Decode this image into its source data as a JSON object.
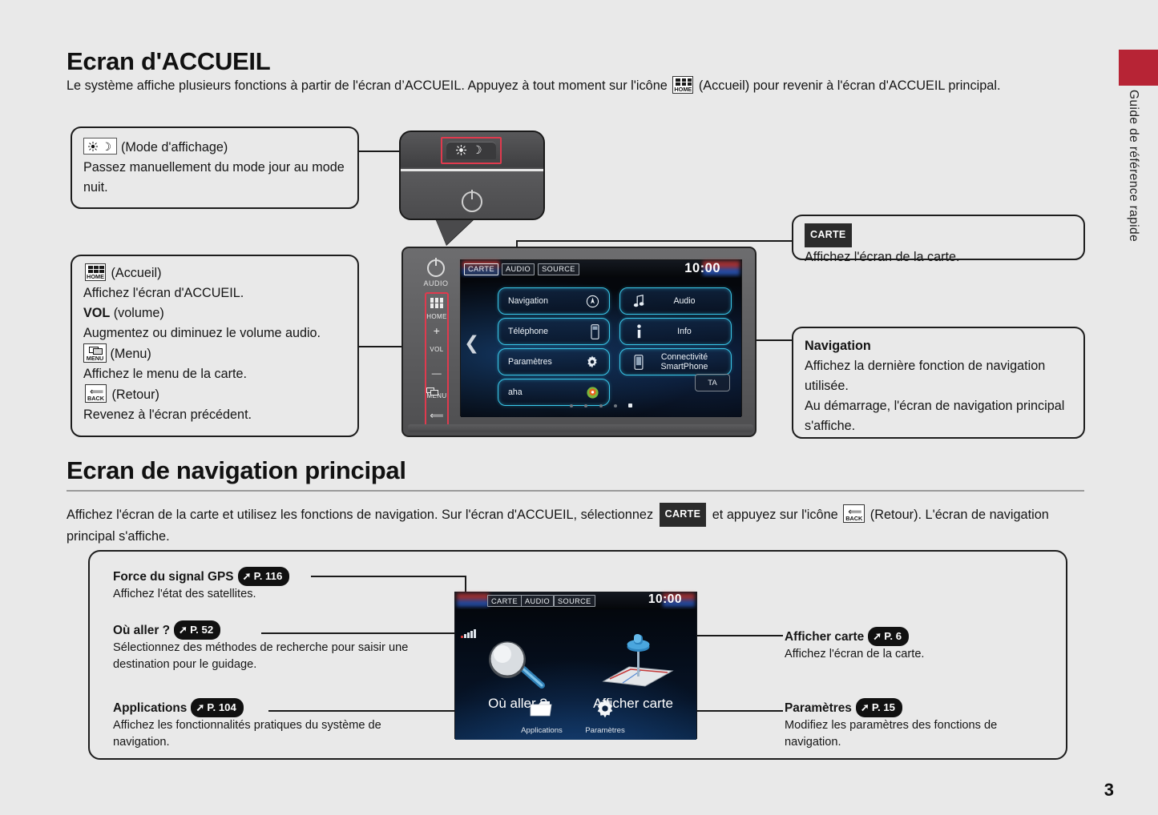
{
  "sidebar": {
    "vertical_title": "Guide de référence rapide"
  },
  "page_number": "3",
  "section1": {
    "heading": "Ecran d'ACCUEIL",
    "intro_part1": "Le système affiche plusieurs fonctions à partir de l'écran d’ACCUEIL. Appuyez à tout moment sur l'icône",
    "intro_part2": "(Accueil) pour revenir à l'écran d'ACCUEIL principal.",
    "home_icon_label": "HOME",
    "callout_display": {
      "title": "(Mode d'affichage)",
      "body": "Passez manuellement du mode jour au mode nuit."
    },
    "callout_buttons": {
      "home_icon_label": "HOME",
      "home_title": "(Accueil)",
      "home_body": "Affichez l'écran d'ACCUEIL.",
      "vol_bold": "VOL",
      "vol_title": "(volume)",
      "vol_body": "Augmentez ou diminuez le volume audio.",
      "menu_icon_label": "MENU",
      "menu_title": "(Menu)",
      "menu_body": "Affichez le menu de la carte.",
      "back_icon_label": "BACK",
      "back_title": "(Retour)",
      "back_body": "Revenez à l'écran précédent."
    },
    "callout_carte": {
      "badge": "CARTE",
      "body": "Affichez l'écran de la carte."
    },
    "callout_nav": {
      "title": "Navigation",
      "body_line1": "Affichez la dernière fonction de navigation utilisée.",
      "body_line2": "Au démarrage, l'écran de navigation principal s'affiche."
    }
  },
  "device": {
    "power_label": "AUDIO",
    "rail": {
      "home": "HOME",
      "plus": "+",
      "vol": "VOL",
      "minus": "—",
      "menu": "MENU",
      "back": "BACK"
    },
    "screen": {
      "tabs": [
        "CARTE",
        "AUDIO",
        "SOURCE"
      ],
      "clock": "10:00",
      "tiles": [
        {
          "label": "Navigation",
          "icon": "compass-icon"
        },
        {
          "label": "Audio",
          "icon": "music-note-icon"
        },
        {
          "label": "Téléphone",
          "icon": "phone-icon"
        },
        {
          "label": "Info",
          "icon": "info-icon"
        },
        {
          "label": "Paramètres",
          "icon": "gear-icon"
        },
        {
          "label": "Connectivité\nSmartPhone",
          "icon": "smartphone-icon"
        },
        {
          "label": "aha",
          "icon": "aha-icon"
        }
      ],
      "ta_button": "TA",
      "page_dots": 5,
      "active_dot": 5
    }
  },
  "section2": {
    "heading": "Ecran de navigation principal",
    "intro_part1": "Affichez l'écran de la carte et utilisez les fonctions de navigation. Sur l'écran d'ACCUEIL, sélectionnez",
    "intro_badge": "CARTE",
    "intro_part2": "et appuyez sur l'icône",
    "back_icon_label": "BACK",
    "intro_part3": "(Retour). L'écran de navigation principal s'affiche.",
    "callouts": [
      {
        "name": "gps-signal",
        "title": "Force du signal GPS",
        "page_ref": "P. 116",
        "body": "Affichez l'état des satellites."
      },
      {
        "name": "where-to",
        "title": "Où aller ?",
        "page_ref": "P. 52",
        "body": "Sélectionnez des méthodes de recherche pour saisir une destination pour le guidage."
      },
      {
        "name": "applications",
        "title": "Applications",
        "page_ref": "P. 104",
        "body": "Affichez les fonctionnalités pratiques du système de navigation."
      },
      {
        "name": "show-map",
        "title": "Afficher carte",
        "page_ref": "P. 6",
        "body": "Affichez l'écran de la carte."
      },
      {
        "name": "settings",
        "title": "Paramètres",
        "page_ref": "P. 15",
        "body": "Modifiez les paramètres des fonctions de navigation."
      }
    ],
    "nav_screen": {
      "tabs": [
        "CARTE",
        "AUDIO",
        "SOURCE"
      ],
      "clock": "10:00",
      "where_to": "Où aller ?",
      "show_map": "Afficher carte",
      "applications": "Applications",
      "settings": "Paramètres"
    }
  },
  "colors": {
    "accent_red": "#b72435",
    "highlight_red": "#e03a4e",
    "tile_cyan": "#39c6e8",
    "page_bg": "#e9e9e9"
  }
}
